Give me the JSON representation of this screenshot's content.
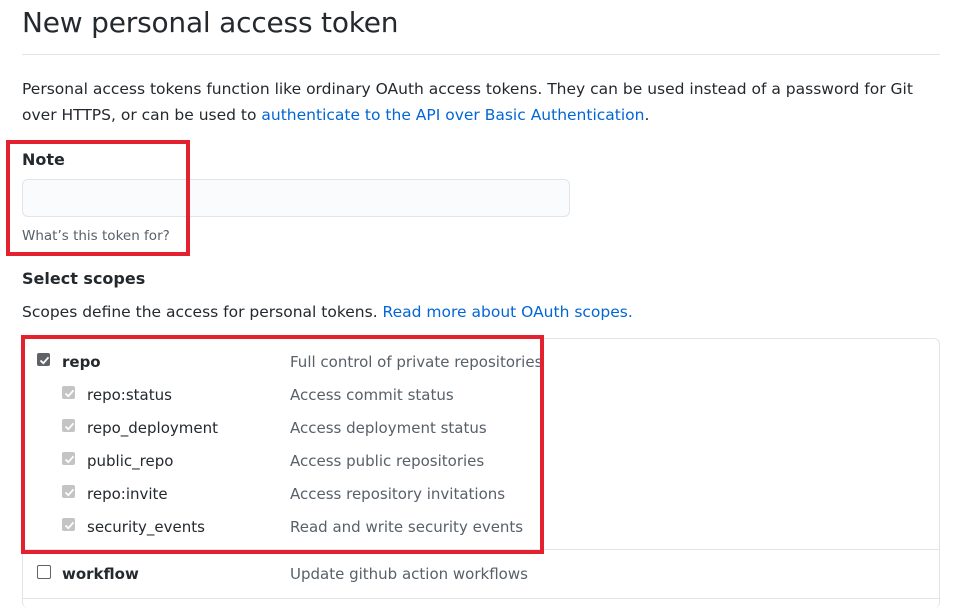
{
  "page": {
    "title": "New personal access token"
  },
  "intro": {
    "text_before": "Personal access tokens function like ordinary OAuth access tokens. They can be used instead of a password for Git over HTTPS, or can be used to ",
    "link_text": "authenticate to the API over Basic Authentication",
    "text_after": "."
  },
  "note": {
    "label": "Note",
    "value": "",
    "placeholder": "",
    "hint": "What’s this token for?"
  },
  "scopes": {
    "heading": "Select scopes",
    "desc_text": "Scopes define the access for personal tokens. ",
    "desc_link": "Read more about OAuth scopes.",
    "items": [
      {
        "name": "repo",
        "description": "Full control of private repositories",
        "checked": true,
        "disabled": false,
        "level": 0
      },
      {
        "name": "repo:status",
        "description": "Access commit status",
        "checked": true,
        "disabled": true,
        "level": 1
      },
      {
        "name": "repo_deployment",
        "description": "Access deployment status",
        "checked": true,
        "disabled": true,
        "level": 1
      },
      {
        "name": "public_repo",
        "description": "Access public repositories",
        "checked": true,
        "disabled": true,
        "level": 1
      },
      {
        "name": "repo:invite",
        "description": "Access repository invitations",
        "checked": true,
        "disabled": true,
        "level": 1
      },
      {
        "name": "security_events",
        "description": "Read and write security events",
        "checked": true,
        "disabled": true,
        "level": 1
      },
      {
        "name": "workflow",
        "description": "Update github action workflows",
        "checked": false,
        "disabled": false,
        "level": 0
      }
    ]
  },
  "colors": {
    "highlight": "#e3212f",
    "link": "#0366d6"
  }
}
